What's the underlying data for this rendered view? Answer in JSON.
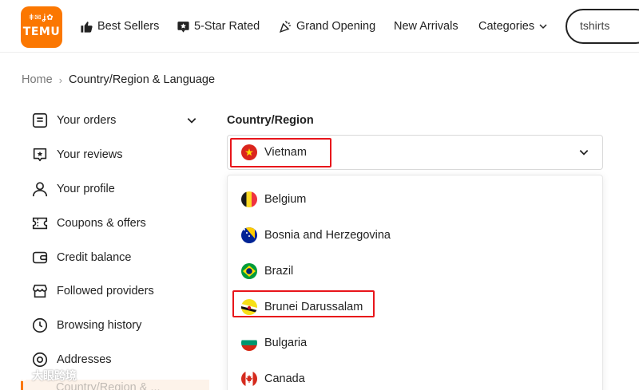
{
  "header": {
    "logo_glyphs": "ǂ✉ʝ✿",
    "logo_text": "TEMU",
    "nav": [
      {
        "label": "Best Sellers",
        "icon": "thumbs-up-icon"
      },
      {
        "label": "5-Star Rated",
        "icon": "star-badge-icon"
      },
      {
        "label": "Grand Opening",
        "icon": "party-popper-icon"
      },
      {
        "label": "New Arrivals",
        "icon": ""
      },
      {
        "label": "Categories",
        "icon": "chevron-down-icon"
      }
    ],
    "search_value": "tshirts"
  },
  "breadcrumb": {
    "home": "Home",
    "separator": "›",
    "current": "Country/Region & Language"
  },
  "sidebar": {
    "items": [
      {
        "label": "Your orders",
        "icon": "orders-icon"
      },
      {
        "label": "Your reviews",
        "icon": "reviews-icon"
      },
      {
        "label": "Your profile",
        "icon": "profile-icon"
      },
      {
        "label": "Coupons & offers",
        "icon": "coupon-icon"
      },
      {
        "label": "Credit balance",
        "icon": "wallet-icon"
      },
      {
        "label": "Followed providers",
        "icon": "store-icon"
      },
      {
        "label": "Browsing history",
        "icon": "clock-icon"
      },
      {
        "label": "Addresses",
        "icon": "location-icon"
      }
    ],
    "active_label": "Country/Region & ..."
  },
  "main": {
    "section_title": "Country/Region",
    "selected": "Vietnam",
    "options": [
      "Belgium",
      "Bosnia and Herzegovina",
      "Brazil",
      "Brunei Darussalam",
      "Bulgaria",
      "Canada"
    ]
  },
  "colors": {
    "accent": "#fb7701",
    "highlight": "#e8151b"
  },
  "watermark": "大眼跨境"
}
